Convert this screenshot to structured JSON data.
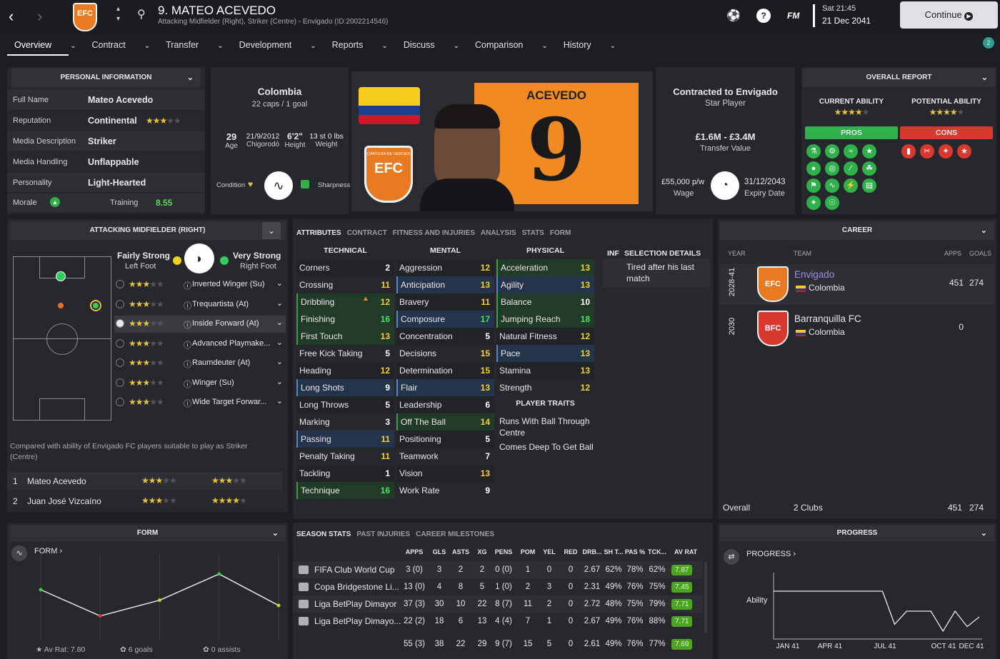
{
  "header": {
    "player_name": "9. MATEO ACEVEDO",
    "subtitle": "Attacking Midfielder (Right), Striker (Centre) - Envigado (ID:2002214546)",
    "time": "Sat 21:45",
    "date": "21 Dec 2041",
    "continue_label": "Continue",
    "fm_label": "FM",
    "notif_count": "2",
    "club_badge": "EFC"
  },
  "tabs": [
    "Overview",
    "Contract",
    "Transfer",
    "Development",
    "Reports",
    "Discuss",
    "Comparison",
    "History"
  ],
  "personal": {
    "title": "PERSONAL INFORMATION",
    "rows": [
      {
        "label": "Full Name",
        "value": "Mateo Acevedo"
      },
      {
        "label": "Reputation",
        "value": "Continental"
      },
      {
        "label": "Media Description",
        "value": "Striker"
      },
      {
        "label": "Media Handling",
        "value": "Unflappable"
      },
      {
        "label": "Personality",
        "value": "Light-Hearted"
      }
    ],
    "morale_label": "Morale",
    "training_label": "Training",
    "training_value": "8.55"
  },
  "nation": {
    "name": "Colombia",
    "caps": "22 caps / 1 goal",
    "age": "29",
    "age_label": "Age",
    "dob": "21/9/2012",
    "birthplace": "Chigorodó",
    "height": "6'2\"",
    "height_label": "Height",
    "weight": "13 st 0 lbs",
    "weight_label": "Weight",
    "condition": "Condition",
    "sharpness": "Sharpness"
  },
  "photo": {
    "shirt_name": "ACEVEDO",
    "shirt_number": "9",
    "club_text": "CANTERA DE HEROES",
    "club_abbr": "EFC"
  },
  "contract": {
    "title": "Contracted to Envigado",
    "status": "Star Player",
    "value": "£1.6M - £3.4M",
    "value_label": "Transfer Value",
    "wage": "£55,000 p/w",
    "wage_label": "Wage",
    "expiry": "31/12/2043",
    "expiry_label": "Expiry Date"
  },
  "report": {
    "title": "OVERALL REPORT",
    "ca_label": "CURRENT ABILITY",
    "pa_label": "POTENTIAL ABILITY",
    "pros": "PROS",
    "cons": "CONS"
  },
  "position": {
    "title": "ATTACKING MIDFIELDER (RIGHT)",
    "left_foot_strength": "Fairly Strong",
    "left_foot": "Left Foot",
    "right_foot_strength": "Very Strong",
    "right_foot": "Right Foot",
    "roles": [
      "Inverted Winger (Su)",
      "Trequartista (At)",
      "Inside Forward (At)",
      "Advanced Playmake...",
      "Raumdeuter (At)",
      "Winger (Su)",
      "Wide Target Forwar..."
    ],
    "compare_text": "Compared with ability of Envigado FC players suitable to play as Striker (Centre)",
    "compare": [
      {
        "rank": "1",
        "name": "Mateo Acevedo"
      },
      {
        "rank": "2",
        "name": "Juan José Vizcaíno"
      }
    ]
  },
  "attr_tabs": [
    "ATTRIBUTES",
    "CONTRACT",
    "FITNESS AND INJURIES",
    "ANALYSIS",
    "STATS",
    "FORM"
  ],
  "attributes": {
    "technical_title": "TECHNICAL",
    "mental_title": "MENTAL",
    "physical_title": "PHYSICAL",
    "technical": [
      [
        "Corners",
        "2"
      ],
      [
        "Crossing",
        "11"
      ],
      [
        "Dribbling",
        "12"
      ],
      [
        "Finishing",
        "16"
      ],
      [
        "First Touch",
        "13"
      ],
      [
        "Free Kick Taking",
        "5"
      ],
      [
        "Heading",
        "12"
      ],
      [
        "Long Shots",
        "9"
      ],
      [
        "Long Throws",
        "5"
      ],
      [
        "Marking",
        "3"
      ],
      [
        "Passing",
        "11"
      ],
      [
        "Penalty Taking",
        "11"
      ],
      [
        "Tackling",
        "1"
      ],
      [
        "Technique",
        "16"
      ]
    ],
    "mental": [
      [
        "Aggression",
        "12"
      ],
      [
        "Anticipation",
        "13"
      ],
      [
        "Bravery",
        "11"
      ],
      [
        "Composure",
        "17"
      ],
      [
        "Concentration",
        "5"
      ],
      [
        "Decisions",
        "15"
      ],
      [
        "Determination",
        "15"
      ],
      [
        "Flair",
        "13"
      ],
      [
        "Leadership",
        "6"
      ],
      [
        "Off The Ball",
        "14"
      ],
      [
        "Positioning",
        "5"
      ],
      [
        "Teamwork",
        "7"
      ],
      [
        "Vision",
        "13"
      ],
      [
        "Work Rate",
        "9"
      ]
    ],
    "physical": [
      [
        "Acceleration",
        "13"
      ],
      [
        "Agility",
        "13"
      ],
      [
        "Balance",
        "10"
      ],
      [
        "Jumping Reach",
        "18"
      ],
      [
        "Natural Fitness",
        "12"
      ],
      [
        "Pace",
        "13"
      ],
      [
        "Stamina",
        "13"
      ],
      [
        "Strength",
        "12"
      ]
    ],
    "traits_title": "PLAYER TRAITS",
    "traits": [
      "Runs With Ball Through Centre",
      "Comes Deep To Get Ball"
    ],
    "inf_label": "INF",
    "selection_title": "SELECTION DETAILS",
    "selection_text": "Tired after his last match"
  },
  "career": {
    "title": "CAREER",
    "col_year": "YEAR",
    "col_team": "TEAM",
    "col_apps": "APPS",
    "col_goals": "GOALS",
    "rows": [
      {
        "year": "2028-41",
        "team": "Envigado",
        "nation": "Colombia",
        "apps": "451",
        "goals": "274",
        "badge": "EFC"
      },
      {
        "year": "2030",
        "team": "Barranquilla FC",
        "nation": "Colombia",
        "apps": "0",
        "goals": "",
        "badge": "BFC"
      }
    ],
    "overall_label": "Overall",
    "clubs": "2 Clubs",
    "total_apps": "451",
    "total_goals": "274"
  },
  "form": {
    "title": "FORM",
    "label": "FORM",
    "av_rat": "Av Rat: 7.80",
    "goals": "6 goals",
    "assists": "0 assists",
    "points": [
      7.9,
      7.4,
      7.7,
      8.2,
      7.6
    ]
  },
  "season_tabs": [
    "SEASON STATS",
    "PAST INJURIES",
    "CAREER MILESTONES"
  ],
  "season": {
    "cols": [
      "APPS",
      "GLS",
      "ASTS",
      "XG",
      "PENS",
      "POM",
      "YEL",
      "RED",
      "DRB...",
      "SH T...",
      "PAS %",
      "TCK...",
      "AV RAT"
    ],
    "rows": [
      {
        "comp": "FIFA Club World Cup",
        "vals": [
          "3 (0)",
          "3",
          "2",
          "2",
          "0 (0)",
          "1",
          "0",
          "0",
          "2.67",
          "62%",
          "78%",
          "62%"
        ],
        "rat": "7.87"
      },
      {
        "comp": "Copa Bridgestone Li...",
        "vals": [
          "13 (0)",
          "4",
          "8",
          "5",
          "1 (0)",
          "2",
          "3",
          "0",
          "2.31",
          "49%",
          "76%",
          "75%"
        ],
        "rat": "7.45"
      },
      {
        "comp": "Liga BetPlay Dimayor",
        "vals": [
          "37 (3)",
          "30",
          "10",
          "22",
          "8 (7)",
          "11",
          "2",
          "0",
          "2.72",
          "48%",
          "75%",
          "79%"
        ],
        "rat": "7.71"
      },
      {
        "comp": "Liga BetPlay Dimayo...",
        "vals": [
          "22 (2)",
          "18",
          "6",
          "13",
          "4 (4)",
          "7",
          "1",
          "0",
          "2.67",
          "49%",
          "76%",
          "88%"
        ],
        "rat": "7.71"
      }
    ],
    "total": {
      "vals": [
        "55 (3)",
        "38",
        "22",
        "29",
        "9 (7)",
        "15",
        "5",
        "0",
        "2.61",
        "49%",
        "76%",
        "77%"
      ],
      "rat": "7.69"
    }
  },
  "progress": {
    "title": "PROGRESS",
    "label": "PROGRESS",
    "ylabel": "Ability",
    "xlabels": [
      "JAN 41",
      "APR 41",
      "JUL 41",
      "OCT 41",
      "DEC 41"
    ],
    "points": [
      0.8,
      0.8,
      0.8,
      0.8,
      0.8,
      0.8,
      0.8,
      0.8,
      0.8,
      0.8,
      0.22,
      0.45,
      0.45,
      0.45,
      0.1,
      0.45,
      0.18,
      0.35
    ]
  }
}
